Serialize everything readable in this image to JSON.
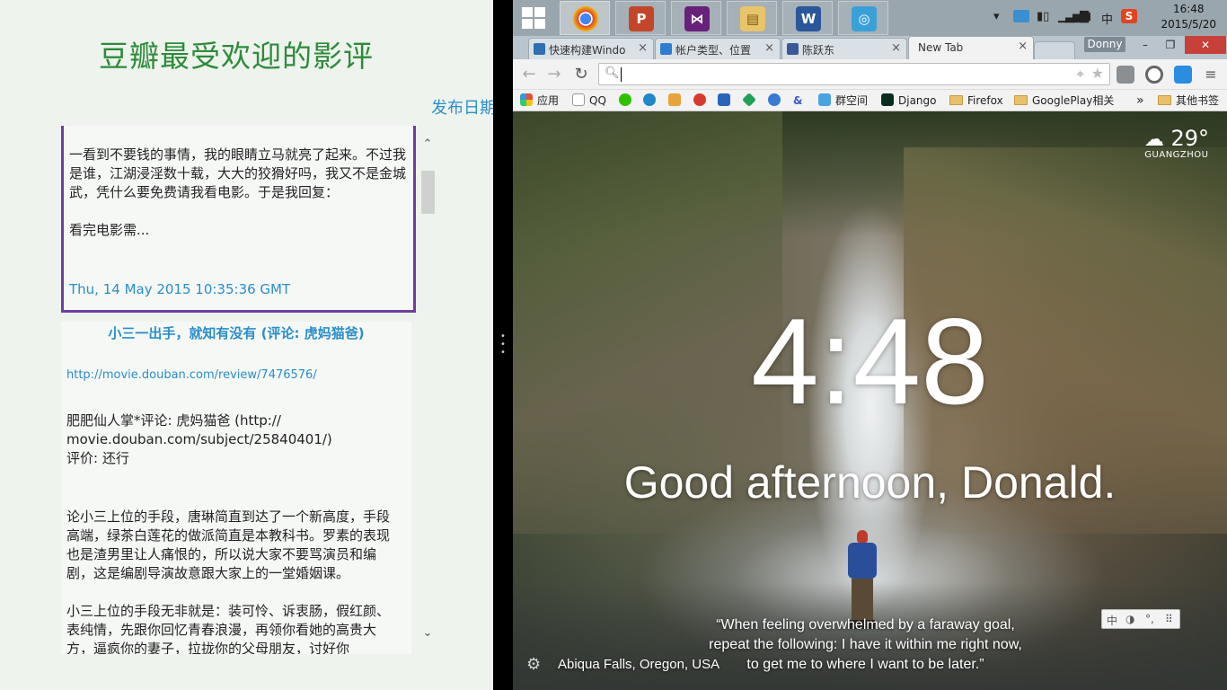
{
  "left_app": {
    "title": "豆瓣最受欢迎的影评",
    "header_right": "发布日期",
    "selected_review": {
      "excerpt": "邀请您观看《晚的电影包场》\n\n一看到不要钱的事情，我的眼睛立马就亮了起来。不过我是谁，江湖浸淫数十载，大大的狡猾好吗，我又不是金城武，凭什么要免费请我看电影。于是我回复：\n\n看完电影需...",
      "date": "Thu, 14 May 2015 10:35:36 GMT"
    },
    "review2": {
      "title": "小三一出手，就知有没有 (评论: 虎妈猫爸)",
      "link": "http://movie.douban.com/review/7476576/",
      "meta": "肥肥仙人掌*评论: 虎妈猫爸 (http://\nmovie.douban.com/subject/25840401/)\n评价: 还行",
      "body": "论小三上位的手段，唐琳简直到达了一个新高度，手段高端，绿茶白莲花的做派简直是本教科书。罗素的表现也是渣男里让人痛恨的，所以说大家不要骂演员和编剧，这是编剧导演故意跟大家上的一堂婚姻课。\n\n小三上位的手段无非就是：装可怜、诉衷肠，假红颜、表纯情，先跟你回忆青春浪漫，再领你看她的高贵大方，逼疯你的妻子，拉拢你的父母朋友，讨好你"
    }
  },
  "taskbar": {
    "apps": [
      {
        "name": "chrome",
        "glyph": "●",
        "color": "#db4437"
      },
      {
        "name": "powerpoint",
        "glyph": "P",
        "color": "#c4462a"
      },
      {
        "name": "visual-studio",
        "glyph": "⋈",
        "color": "#68217a"
      },
      {
        "name": "file-explorer",
        "glyph": "▤",
        "color": "#e9c46a"
      },
      {
        "name": "word",
        "glyph": "W",
        "color": "#2b579a"
      },
      {
        "name": "network-app",
        "glyph": "◎",
        "color": "#3aa0d8"
      }
    ],
    "tray": {
      "show_hidden": "▾",
      "ime_label": "中",
      "sogou": "S"
    },
    "clock": {
      "time": "16:48",
      "date": "2015/5/20"
    }
  },
  "browser": {
    "tabs": [
      {
        "label": "快速构建Windo",
        "favicon_color": "#2f6fb0"
      },
      {
        "label": "帐户类型、位置",
        "favicon_color": "#2d7dd2"
      },
      {
        "label": "陈跃东",
        "favicon_color": "#3b5998"
      },
      {
        "label": "New Tab",
        "favicon_color": ""
      }
    ],
    "close_glyph": "×",
    "profile_name": "Donny",
    "window_buttons": {
      "minimize": "–",
      "restore": "❐",
      "close": "✕"
    },
    "omnibox": {
      "value": ""
    },
    "bookmarks": [
      {
        "label": "应用",
        "icon": "apps-grid",
        "color": "#e74c3c"
      },
      {
        "label": "QQ",
        "icon": "page",
        "color": "#ffffff"
      },
      {
        "label": "",
        "icon": "wechat",
        "color": "#2dc100"
      },
      {
        "label": "",
        "icon": "github",
        "color": "#1e88c8"
      },
      {
        "label": "",
        "icon": "note",
        "color": "#e8a33b"
      },
      {
        "label": "",
        "icon": "xiu",
        "color": "#d63b2f"
      },
      {
        "label": "",
        "icon": "s5",
        "color": "#2a64b8"
      },
      {
        "label": "",
        "icon": "diamond",
        "color": "#22a05a"
      },
      {
        "label": "",
        "icon": "link",
        "color": "#3a7ad0"
      },
      {
        "label": "",
        "icon": "ampersand",
        "color": "#3a5fcd"
      },
      {
        "label": "群空间",
        "icon": "group",
        "color": "#4aa3e0"
      },
      {
        "label": "Django",
        "icon": "django",
        "color": "#092e20"
      },
      {
        "label": "Firefox",
        "icon": "folder",
        "color": "#e8c06b"
      },
      {
        "label": "GooglePlay相关",
        "icon": "folder",
        "color": "#e8c06b"
      }
    ],
    "bookmarks_more": "»",
    "other_bookmarks": "其他书签"
  },
  "new_tab": {
    "weather": {
      "temp": "29°",
      "city": "GUANGZHOU"
    },
    "time": "4:48",
    "greeting": "Good afternoon, Donald.",
    "quote": "“When feeling overwhelmed by a faraway goal,\nrepeat the following: I have it within me right now,\nto get me to where I want to be later.”",
    "photo_location": "Abiqua Falls, Oregon, USA",
    "ime_toolbar": [
      "中",
      "◑",
      "°,",
      "⠿"
    ]
  }
}
